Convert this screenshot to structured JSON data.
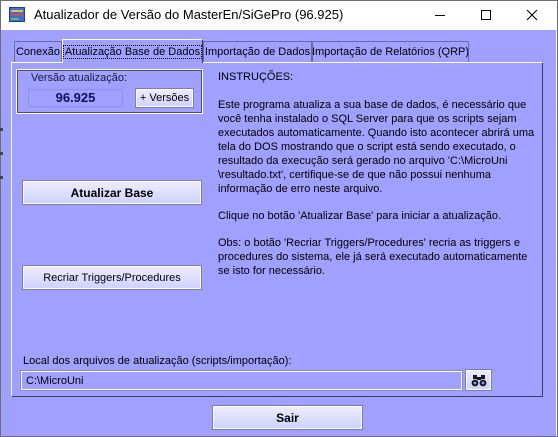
{
  "window": {
    "title": "Atualizador de Versão do MasterEn/SiGePro (96.925)",
    "icon": "app-icon"
  },
  "tabs": [
    {
      "label": "Conexão"
    },
    {
      "label": "Atualização Base de Dados",
      "active": true
    },
    {
      "label": "Importação de Dados"
    },
    {
      "label": "Importação de Relatórios (QRP)"
    }
  ],
  "version": {
    "label": "Versão atualização:",
    "value": "96.925",
    "more_button": "+ Versões"
  },
  "actions": {
    "update_base": "Atualizar Base",
    "recreate": "Recriar Triggers/Procedures",
    "exit": "Sair"
  },
  "instructions": {
    "heading": "INSTRUÇÕES:",
    "p1": "Este programa atualiza a sua base de dados, é necessário que você tenha instalado o SQL Server para que os scripts sejam executados automaticamente. Quando isto acontecer abrirá uma tela do DOS mostrando que o script está sendo executado, o resultado da execução será gerado no arquivo 'C:\\MicroUni \\resultado.txt', certifique-se de que não possui nenhuma informação de erro neste arquivo.",
    "p2": "Clique no botão 'Atualizar Base' para iniciar a atualização.",
    "p3": "Obs: o botão 'Recriar Triggers/Procedures' recria as triggers e procedures do sistema, ele já será executado automaticamente se isto for necessário."
  },
  "local": {
    "label": "Local dos arquivos de atualização (scripts/importação):",
    "path": "C:\\MicroUni",
    "browse_icon": "binoculars-icon"
  },
  "colors": {
    "client_bg": "#a0a0ff",
    "version_text": "#101060"
  }
}
